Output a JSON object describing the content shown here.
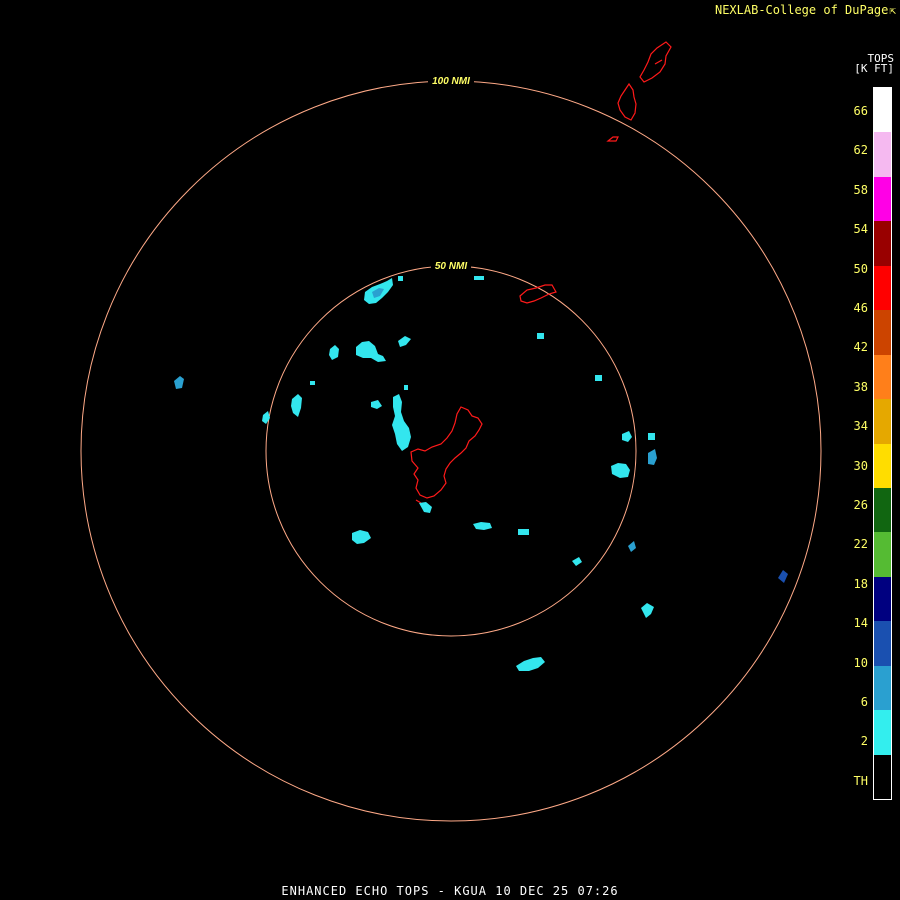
{
  "header": {
    "credit": "NEXLAB-College of DuPage",
    "credit_icon": "external-arrow-icon"
  },
  "legend": {
    "title_line1": "TOPS",
    "title_line2": "[K FT]",
    "colors": [
      "#ffffff",
      "#f5b9f0",
      "#ff00e6",
      "#990000",
      "#ff0000",
      "#cc4400",
      "#ff7f1a",
      "#e5a800",
      "#ffdd00",
      "#116611",
      "#55bb33",
      "#000080",
      "#1a50b0",
      "#2aa0d0",
      "#33eeee",
      "#000000"
    ],
    "labels": [
      "66",
      "62",
      "58",
      "54",
      "50",
      "46",
      "42",
      "38",
      "34",
      "30",
      "26",
      "22",
      "18",
      "14",
      "10",
      "6",
      "2",
      "TH"
    ]
  },
  "rings": [
    {
      "label": "100 NMI",
      "radius_nmi": 100
    },
    {
      "label": "50 NMI",
      "radius_nmi": 50
    }
  ],
  "colors": {
    "ring": "#ffaa88",
    "ring_label": "#ffff66",
    "coast": "#ff1a1a",
    "echo_low": "#33e6ee",
    "echo_mid": "#2aa0d0",
    "echo_14": "#1a50b0"
  },
  "footer": {
    "caption": "ENHANCED ECHO TOPS - KGUA 10 DEC 25 07:26"
  }
}
